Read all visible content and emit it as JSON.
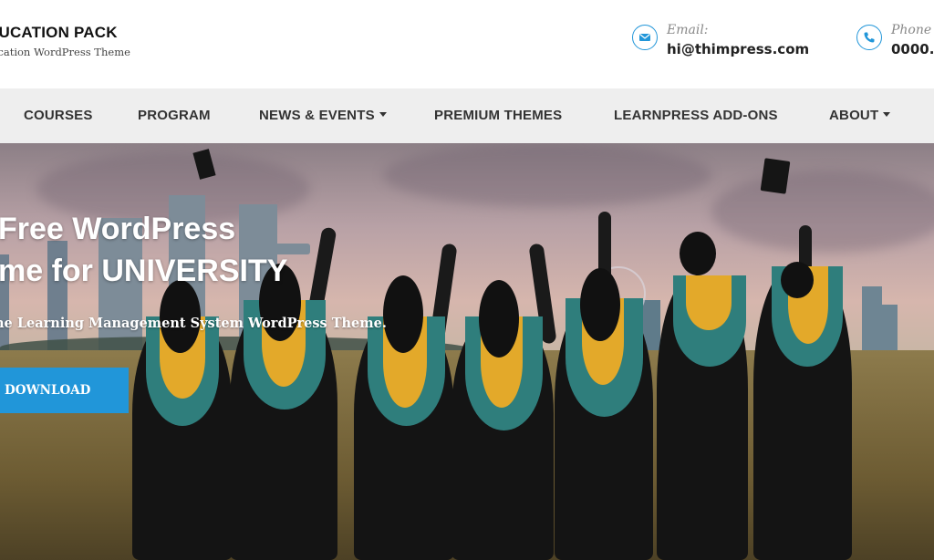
{
  "brand": {
    "title": "DUCATION PACK",
    "subtitle": "ucation WordPress Theme"
  },
  "contacts": {
    "email": {
      "label": "Email:",
      "value": "hi@thimpress.com",
      "icon": "envelope-icon"
    },
    "phone": {
      "label": "Phone",
      "value": "0000.",
      "icon": "phone-icon"
    }
  },
  "nav": {
    "items": [
      {
        "label": "COURSES",
        "dropdown": false
      },
      {
        "label": "PROGRAM",
        "dropdown": false
      },
      {
        "label": "NEWS & EVENTS",
        "dropdown": true
      },
      {
        "label": "PREMIUM THEMES",
        "dropdown": false
      },
      {
        "label": "LEARNPRESS ADD-ONS",
        "dropdown": false
      },
      {
        "label": "ABOUT",
        "dropdown": true
      }
    ]
  },
  "hero": {
    "title_line1": "Free WordPress",
    "title_line2": "me for UNIVERSITY",
    "subtitle": "ne Learning Management System WordPress Theme.",
    "button_label": "E DOWNLOAD"
  },
  "colors": {
    "accent": "#2196d9",
    "nav_bg": "#eeeeee",
    "text_dark": "#333333"
  }
}
